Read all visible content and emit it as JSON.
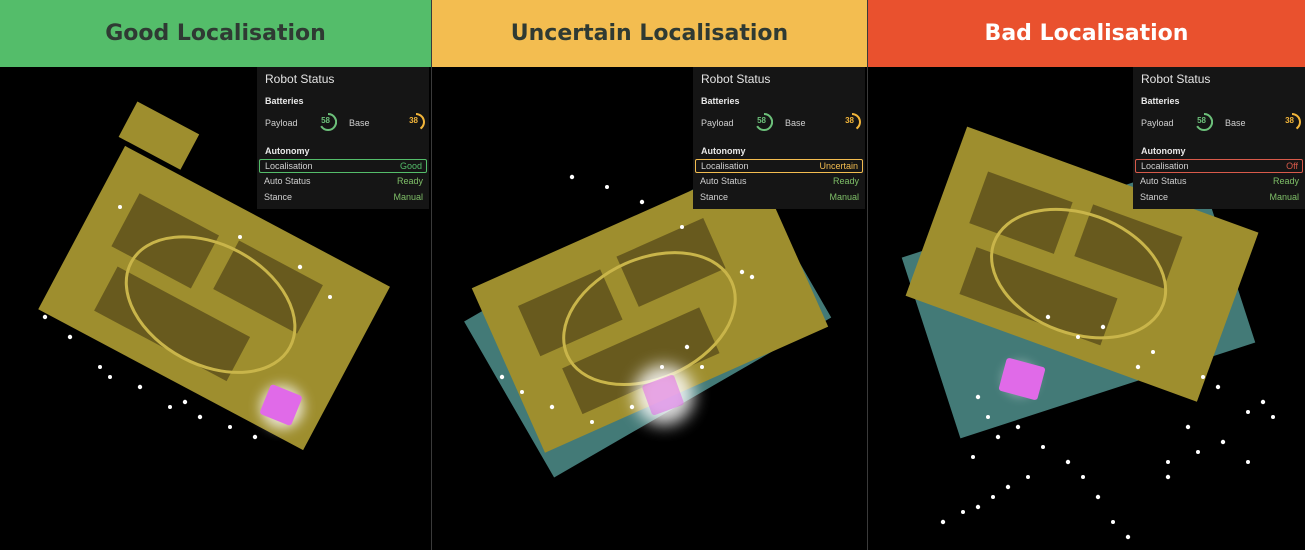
{
  "colors": {
    "good": "#54bd6a",
    "uncertain": "#f3bd50",
    "bad": "#e9512e",
    "header_text_dark": "#2f3a33",
    "header_text_light": "#ffffff",
    "map_fill": "#9e8e2e",
    "map_teal": "#4f8f8c",
    "robot_marker": "#e06ae8",
    "gauge_payload": "#6cc07a",
    "gauge_base": "#f2b53a",
    "status_ok": "#7fbf68",
    "status_bad": "#d85a4a",
    "panel_bg": "#151515"
  },
  "panels": [
    {
      "header": "Good Localisation",
      "status": {
        "title": "Robot Status",
        "batteries_label": "Batteries",
        "payload_label": "Payload",
        "payload_value": "58",
        "base_label": "Base",
        "base_value": "38",
        "autonomy_label": "Autonomy",
        "localisation_label": "Localisation",
        "localisation_value": "Good",
        "auto_status_label": "Auto Status",
        "auto_status_value": "Ready",
        "stance_label": "Stance",
        "stance_value": "Manual"
      }
    },
    {
      "header": "Uncertain Localisation",
      "status": {
        "title": "Robot Status",
        "batteries_label": "Batteries",
        "payload_label": "Payload",
        "payload_value": "58",
        "base_label": "Base",
        "base_value": "38",
        "autonomy_label": "Autonomy",
        "localisation_label": "Localisation",
        "localisation_value": "Uncertain",
        "auto_status_label": "Auto Status",
        "auto_status_value": "Ready",
        "stance_label": "Stance",
        "stance_value": "Manual"
      }
    },
    {
      "header": "Bad Localisation",
      "status": {
        "title": "Robot Status",
        "batteries_label": "Batteries",
        "payload_label": "Payload",
        "payload_value": "58",
        "base_label": "Base",
        "base_value": "38",
        "autonomy_label": "Autonomy",
        "localisation_label": "Localisation",
        "localisation_value": "Off",
        "auto_status_label": "Auto Status",
        "auto_status_value": "Ready",
        "stance_label": "Stance",
        "stance_value": "Manual"
      }
    }
  ]
}
